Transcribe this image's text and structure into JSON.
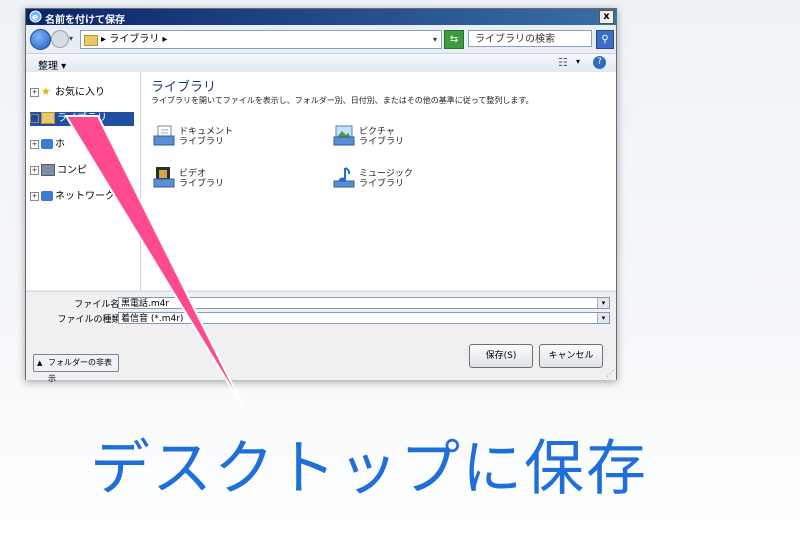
{
  "window": {
    "title": "名前を付けて保存",
    "close_label": "x"
  },
  "addressbar": {
    "path": "ライブラリ",
    "search_placeholder": "ライブラリの検索",
    "path_prefix": "▸",
    "path_suffix": "▸"
  },
  "toolbar": {
    "organize_label": "整理 ▾",
    "help_label": "?"
  },
  "navpane": {
    "items": [
      {
        "label": "お気に入り",
        "selected": false
      },
      {
        "label": "ライブラリ",
        "selected": true
      },
      {
        "label": "ホ",
        "selected": false
      },
      {
        "label": "コンピ",
        "selected": false
      },
      {
        "label": "ネットワーク",
        "selected": false
      }
    ]
  },
  "content": {
    "title": "ライブラリ",
    "description": "ライブラリを開いてファイルを表示し、フォルダー別、日付別、またはその他の基準に従って整列します。",
    "libraries": [
      {
        "line1": "ドキュメント",
        "line2": "ライブラリ",
        "icon": "document-library-icon"
      },
      {
        "line1": "ピクチャ",
        "line2": "ライブラリ",
        "icon": "picture-library-icon"
      },
      {
        "line1": "ビデオ",
        "line2": "ライブラリ",
        "icon": "video-library-icon"
      },
      {
        "line1": "ミュージック",
        "line2": "ライブラリ",
        "icon": "music-library-icon"
      }
    ]
  },
  "form": {
    "filename_label": "ファイル名(N):",
    "filename_value": "黒電話.m4r",
    "filetype_label": "ファイルの種類(T):",
    "filetype_value": "着信音 (*.m4r)"
  },
  "buttons": {
    "hide_folders": "フォルダーの非表示",
    "save": "保存(S)",
    "cancel": "キャンセル"
  },
  "overlay": {
    "caption": "デスクトップに保存",
    "arrow_color": "#ff4a8f",
    "caption_color": "#1e6fd9"
  }
}
